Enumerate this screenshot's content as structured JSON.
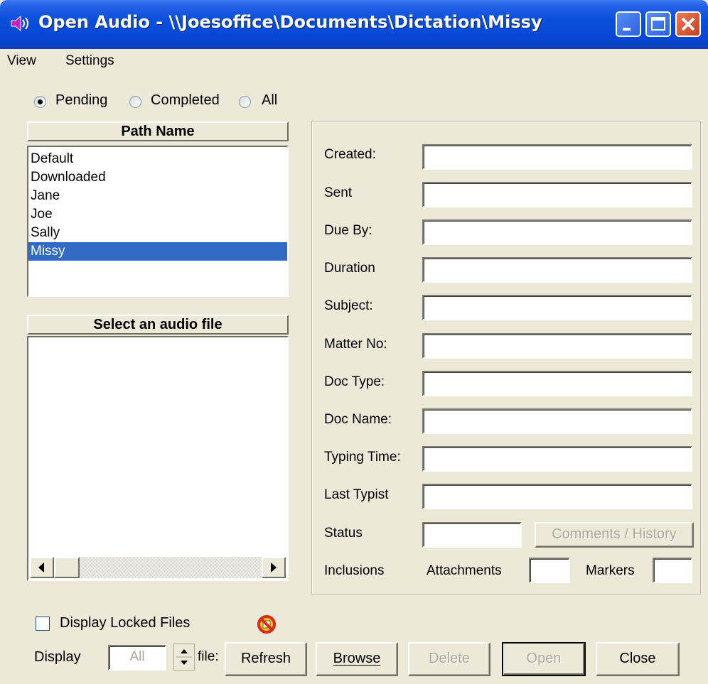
{
  "window": {
    "title": "Open Audio - \\\\Joesoffice\\Documents\\Dictation\\Missy"
  },
  "menu": {
    "items": [
      "View",
      "Settings"
    ]
  },
  "filter": {
    "options": [
      "Pending",
      "Completed",
      "All"
    ],
    "selected": "Pending"
  },
  "path_panel": {
    "header": "Path Name",
    "items": [
      "Default",
      "Downloaded",
      "Jane",
      "Joe",
      "Sally",
      "Missy"
    ],
    "selected": "Missy"
  },
  "audio_panel": {
    "header": "Select an audio file",
    "items": []
  },
  "details": {
    "fields": [
      {
        "label": "Created:",
        "value": ""
      },
      {
        "label": "Sent",
        "value": ""
      },
      {
        "label": "Due By:",
        "value": ""
      },
      {
        "label": "Duration",
        "value": ""
      },
      {
        "label": "Subject:",
        "value": ""
      },
      {
        "label": "Matter No:",
        "value": ""
      },
      {
        "label": "Doc Type:",
        "value": ""
      },
      {
        "label": "Doc Name:",
        "value": ""
      },
      {
        "label": "Typing Time:",
        "value": ""
      },
      {
        "label": "Last Typist",
        "value": ""
      }
    ],
    "status_label": "Status",
    "status_value": "",
    "comments_button": "Comments / History",
    "inclusions_label": "Inclusions",
    "attachments_label": "Attachments",
    "attachments_value": "",
    "markers_label": "Markers",
    "markers_value": ""
  },
  "bottom": {
    "display_locked_label": "Display Locked Files",
    "display_locked_checked": false,
    "display_label": "Display",
    "display_value": "All",
    "files_label": "file:",
    "buttons": {
      "refresh": "Refresh",
      "browse": "Browse",
      "delete": "Delete",
      "open": "Open",
      "close": "Close"
    }
  },
  "colors": {
    "selection": "#316ac5",
    "titlebar": "#0a4fdc",
    "window_bg": "#ece9d8"
  }
}
